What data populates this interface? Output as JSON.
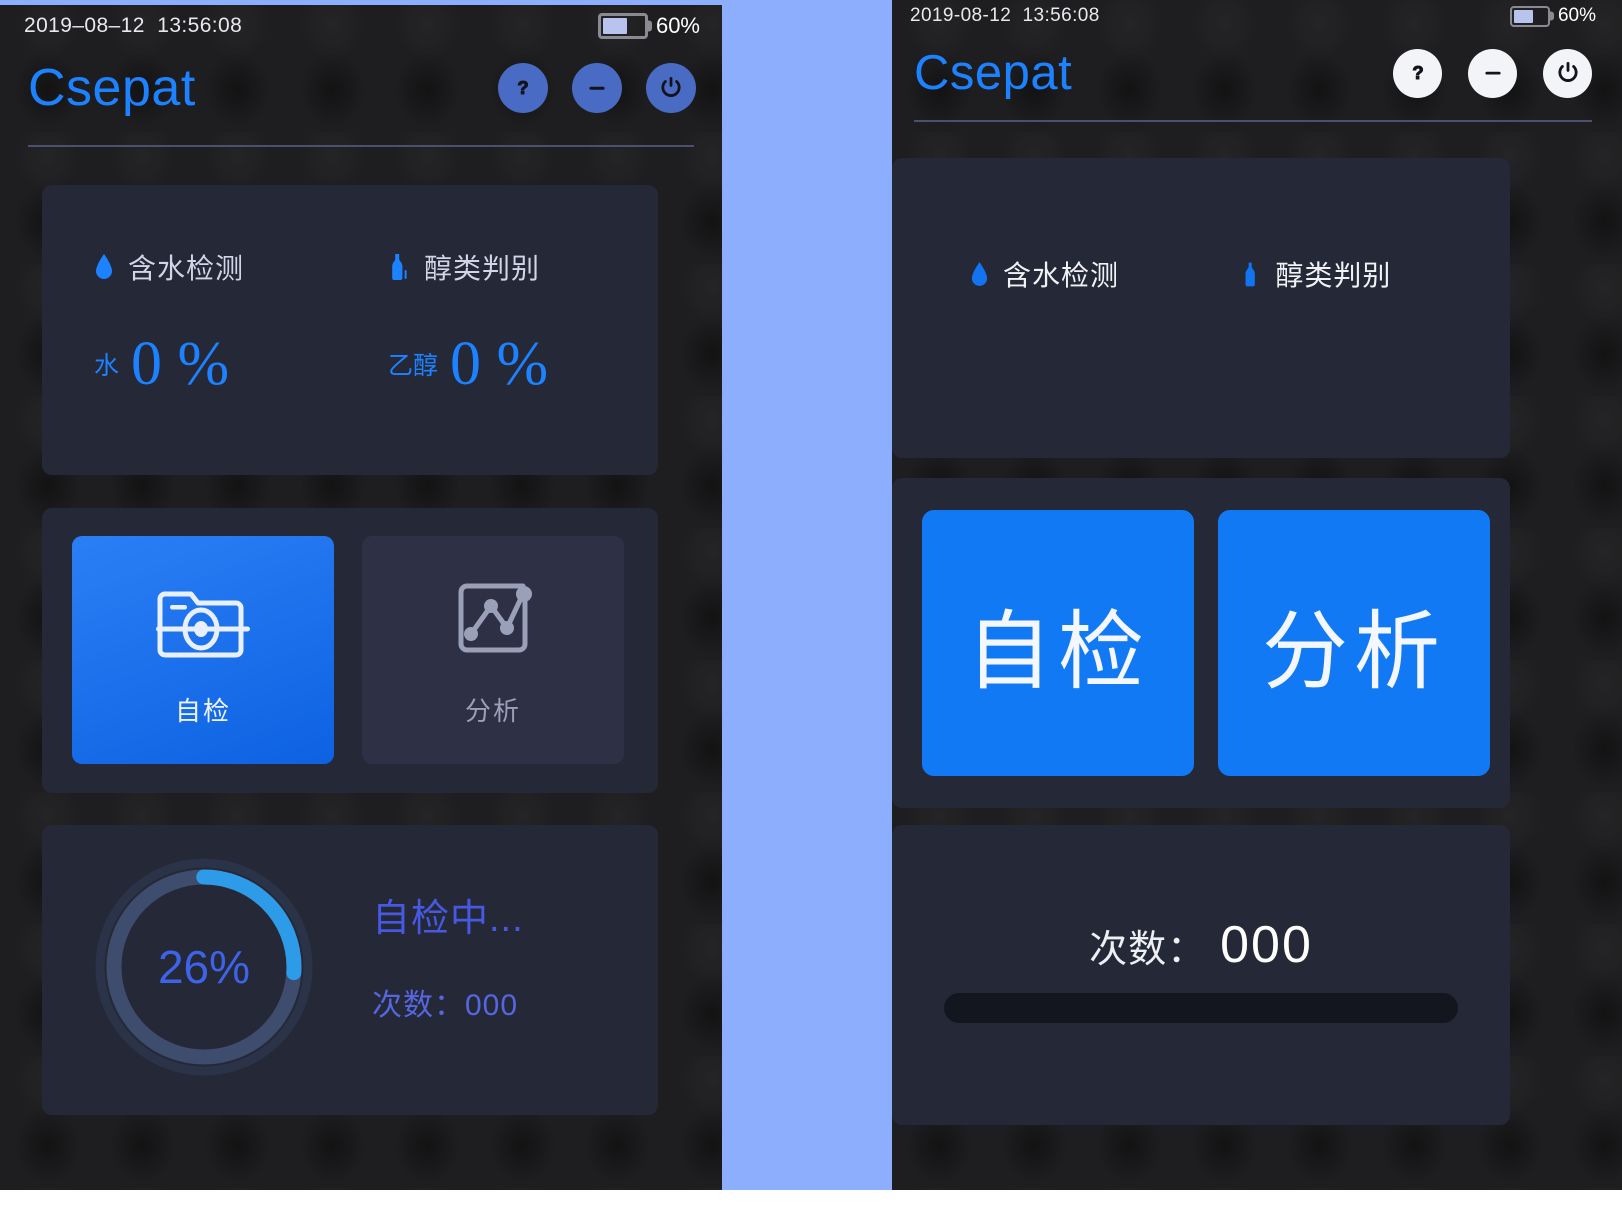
{
  "left_panel": {
    "status": {
      "datetime": "2019–08–12  13:56:08",
      "battery_percent": "60%",
      "battery_level": 60
    },
    "header": {
      "brand": "Csepat",
      "actions": [
        {
          "name": "help-button",
          "icon": "question-mark-icon"
        },
        {
          "name": "minimize-button",
          "icon": "minus-icon"
        },
        {
          "name": "power-button",
          "icon": "power-icon"
        }
      ]
    },
    "readings": {
      "items": [
        {
          "icon": "water-drop-icon",
          "title": "含水检测",
          "unit": "水",
          "value": "0 %"
        },
        {
          "icon": "bottle-icon",
          "title": "醇类判别",
          "unit": "乙醇",
          "value": "0 %"
        }
      ]
    },
    "actions": {
      "tiles": [
        {
          "label": "自检",
          "icon": "scanner-icon",
          "state": "active"
        },
        {
          "label": "分析",
          "icon": "line-chart-icon",
          "state": "inactive"
        }
      ]
    },
    "progress": {
      "percent_label": "26%",
      "percent_value": 26,
      "status_text": "自检中...",
      "count_text": "次数：000"
    }
  },
  "right_panel": {
    "status": {
      "datetime": "2019-08-12  13:56:08",
      "battery_percent": "60%",
      "battery_level": 60
    },
    "header": {
      "brand": "Csepat",
      "actions": [
        {
          "name": "help-button",
          "icon": "question-mark-icon"
        },
        {
          "name": "minimize-button",
          "icon": "minus-icon"
        },
        {
          "name": "power-button",
          "icon": "power-icon"
        }
      ]
    },
    "readings": {
      "items": [
        {
          "icon": "water-drop-icon",
          "title": "含水检测"
        },
        {
          "icon": "bottle-icon",
          "title": "醇类判别"
        }
      ]
    },
    "actions": {
      "buttons": [
        {
          "label": "自检"
        },
        {
          "label": "分析"
        }
      ]
    },
    "status_card": {
      "count_label": "次数：",
      "count_value": "000",
      "progress_value": 0
    }
  },
  "colors": {
    "accent_blue": "#1d82ff",
    "button_blue": "#1279f5",
    "ring_progress": "#2e9be8",
    "ring_track": "#3e4c6e",
    "card_bg": "#252836",
    "panel_bg": "#1e1e20",
    "separator": "#8dadfd",
    "indigo_text": "#4659e3"
  }
}
